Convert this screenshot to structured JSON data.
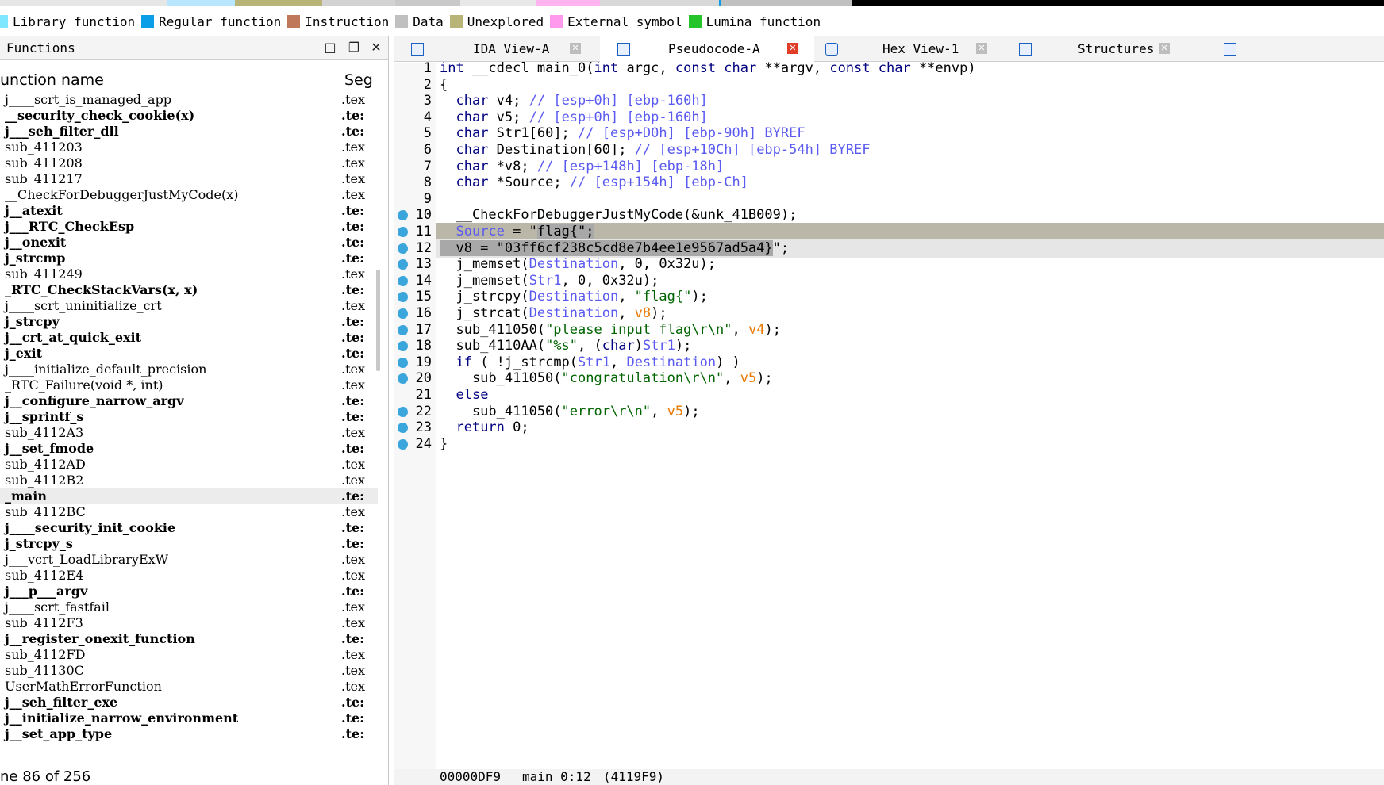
{
  "legend": [
    {
      "label": "Library function",
      "color": "#7fe7ff"
    },
    {
      "label": "Regular function",
      "color": "#0a9ee8"
    },
    {
      "label": "Instruction",
      "color": "#c0785a"
    },
    {
      "label": "Data",
      "color": "#c0c0c0"
    },
    {
      "label": "Unexplored",
      "color": "#b8b478"
    },
    {
      "label": "External symbol",
      "color": "#ff99ee"
    },
    {
      "label": "Lumina function",
      "color": "#25c42a"
    }
  ],
  "functions_panel": {
    "title": "Functions",
    "col_name": "unction name",
    "col_seg": "Seg",
    "status": "ne 86 of 256",
    "rows": [
      {
        "name": "j____scrt_is_managed_app",
        "seg": ".tex",
        "bold": false
      },
      {
        "name": "__security_check_cookie(x)",
        "seg": ".te:",
        "bold": true
      },
      {
        "name": "j___seh_filter_dll",
        "seg": ".te:",
        "bold": true
      },
      {
        "name": "sub_411203",
        "seg": ".tex",
        "bold": false
      },
      {
        "name": "sub_411208",
        "seg": ".tex",
        "bold": false
      },
      {
        "name": "sub_411217",
        "seg": ".tex",
        "bold": false
      },
      {
        "name": "__CheckForDebuggerJustMyCode(x)",
        "seg": ".tex",
        "bold": false
      },
      {
        "name": "j__atexit",
        "seg": ".te:",
        "bold": true
      },
      {
        "name": "j___RTC_CheckEsp",
        "seg": ".te:",
        "bold": true
      },
      {
        "name": "j__onexit",
        "seg": ".te:",
        "bold": true
      },
      {
        "name": "j_strcmp",
        "seg": ".te:",
        "bold": true
      },
      {
        "name": "sub_411249",
        "seg": ".tex",
        "bold": false
      },
      {
        "name": "_RTC_CheckStackVars(x, x)",
        "seg": ".te:",
        "bold": true
      },
      {
        "name": "j____scrt_uninitialize_crt",
        "seg": ".tex",
        "bold": false
      },
      {
        "name": "j_strcpy",
        "seg": ".te:",
        "bold": true
      },
      {
        "name": "j__crt_at_quick_exit",
        "seg": ".te:",
        "bold": true
      },
      {
        "name": "j_exit",
        "seg": ".te:",
        "bold": true
      },
      {
        "name": "j____initialize_default_precision",
        "seg": ".tex",
        "bold": false
      },
      {
        "name": "_RTC_Failure(void *, int)",
        "seg": ".tex",
        "bold": false
      },
      {
        "name": "j__configure_narrow_argv",
        "seg": ".te:",
        "bold": true
      },
      {
        "name": "j__sprintf_s",
        "seg": ".te:",
        "bold": true
      },
      {
        "name": "sub_4112A3",
        "seg": ".tex",
        "bold": false
      },
      {
        "name": "j__set_fmode",
        "seg": ".te:",
        "bold": true
      },
      {
        "name": "sub_4112AD",
        "seg": ".tex",
        "bold": false
      },
      {
        "name": "sub_4112B2",
        "seg": ".tex",
        "bold": false
      },
      {
        "name": "_main",
        "seg": ".te:",
        "bold": true,
        "selected": true
      },
      {
        "name": "sub_4112BC",
        "seg": ".tex",
        "bold": false
      },
      {
        "name": "j____security_init_cookie",
        "seg": ".te:",
        "bold": true
      },
      {
        "name": "j_strcpy_s",
        "seg": ".te:",
        "bold": true
      },
      {
        "name": "j___vcrt_LoadLibraryExW",
        "seg": ".tex",
        "bold": false
      },
      {
        "name": "sub_4112E4",
        "seg": ".tex",
        "bold": false
      },
      {
        "name": "j___p___argv",
        "seg": ".te:",
        "bold": true
      },
      {
        "name": "j____scrt_fastfail",
        "seg": ".tex",
        "bold": false
      },
      {
        "name": "sub_4112F3",
        "seg": ".tex",
        "bold": false
      },
      {
        "name": "j__register_onexit_function",
        "seg": ".te:",
        "bold": true
      },
      {
        "name": "sub_4112FD",
        "seg": ".tex",
        "bold": false
      },
      {
        "name": "sub_41130C",
        "seg": ".tex",
        "bold": false
      },
      {
        "name": "UserMathErrorFunction",
        "seg": ".tex",
        "bold": false
      },
      {
        "name": "j__seh_filter_exe",
        "seg": ".te:",
        "bold": true
      },
      {
        "name": "j__initialize_narrow_environment",
        "seg": ".te:",
        "bold": true
      },
      {
        "name": "j__set_app_type",
        "seg": ".te:",
        "bold": true
      }
    ]
  },
  "tabs": [
    {
      "label": "IDA View-A",
      "active": false
    },
    {
      "label": "Pseudocode-A",
      "active": true
    },
    {
      "label": "Hex View-1",
      "active": false
    },
    {
      "label": "Structures",
      "active": false
    }
  ],
  "code_lines": [
    {
      "n": "1",
      "bp": false,
      "hl": "",
      "html": "<span class='k'>int</span> __cdecl main_0(<span class='k'>int</span> argc, <span class='k'>const char</span> **argv, <span class='k'>const char</span> **envp)"
    },
    {
      "n": "2",
      "bp": false,
      "hl": "",
      "html": "{"
    },
    {
      "n": "3",
      "bp": false,
      "hl": "",
      "html": "  <span class='k'>char</span> v4; <span class='cm'>// [esp+0h] [ebp-160h]</span>"
    },
    {
      "n": "4",
      "bp": false,
      "hl": "",
      "html": "  <span class='k'>char</span> v5; <span class='cm'>// [esp+0h] [ebp-160h]</span>"
    },
    {
      "n": "5",
      "bp": false,
      "hl": "",
      "html": "  <span class='k'>char</span> Str1[60]; <span class='cm'>// [esp+D0h] [ebp-90h] BYREF</span>"
    },
    {
      "n": "6",
      "bp": false,
      "hl": "",
      "html": "  <span class='k'>char</span> Destination[60]; <span class='cm'>// [esp+10Ch] [ebp-54h] BYREF</span>"
    },
    {
      "n": "7",
      "bp": false,
      "hl": "",
      "html": "  <span class='k'>char</span> *v8; <span class='cm'>// [esp+148h] [ebp-18h]</span>"
    },
    {
      "n": "8",
      "bp": false,
      "hl": "",
      "html": "  <span class='k'>char</span> *Source; <span class='cm'>// [esp+154h] [ebp-Ch]</span>"
    },
    {
      "n": "9",
      "bp": false,
      "hl": "",
      "html": ""
    },
    {
      "n": "10",
      "bp": true,
      "hl": "",
      "html": "  __CheckForDebuggerJustMyCode(&amp;unk_41B009);"
    },
    {
      "n": "11",
      "bp": true,
      "hl": "hl1",
      "html": "  <span class='v'>Source</span> = \"<span class='sel'>flag{\";</span>"
    },
    {
      "n": "12",
      "bp": true,
      "hl": "hl2",
      "html": "<span class='sel'>  v8 = \"03ff6cf238c5cd8e7b4ee1e9567ad5a4}</span>\";"
    },
    {
      "n": "13",
      "bp": true,
      "hl": "",
      "html": "  j_memset(<span class='v'>Destination</span>, 0, 0x32u);"
    },
    {
      "n": "14",
      "bp": true,
      "hl": "",
      "html": "  j_memset(<span class='v'>Str1</span>, 0, 0x32u);"
    },
    {
      "n": "15",
      "bp": true,
      "hl": "",
      "html": "  j_strcpy(<span class='v'>Destination</span>, <span class='s'>\"flag{\"</span>);"
    },
    {
      "n": "16",
      "bp": true,
      "hl": "",
      "html": "  j_strcat(<span class='v'>Destination</span>, <span class='o'>v8</span>);"
    },
    {
      "n": "17",
      "bp": true,
      "hl": "",
      "html": "  sub_411050(<span class='s'>\"please input flag\\r\\n\"</span>, <span class='o'>v4</span>);"
    },
    {
      "n": "18",
      "bp": true,
      "hl": "",
      "html": "  sub_4110AA(<span class='s'>\"%s\"</span>, (<span class='k'>char</span>)<span class='v'>Str1</span>);"
    },
    {
      "n": "19",
      "bp": true,
      "hl": "",
      "html": "  <span class='k'>if</span> ( !j_strcmp(<span class='v'>Str1</span>, <span class='v'>Destination</span>) )"
    },
    {
      "n": "20",
      "bp": true,
      "hl": "",
      "html": "    sub_411050(<span class='s'>\"congratulation\\r\\n\"</span>, <span class='o'>v5</span>);"
    },
    {
      "n": "21",
      "bp": false,
      "hl": "",
      "html": "  <span class='k'>else</span>"
    },
    {
      "n": "22",
      "bp": true,
      "hl": "",
      "html": "    sub_411050(<span class='s'>\"error\\r\\n\"</span>, <span class='o'>v5</span>);"
    },
    {
      "n": "23",
      "bp": true,
      "hl": "",
      "html": "  <span class='k'>return</span> 0;"
    },
    {
      "n": "24",
      "bp": true,
      "hl": "",
      "html": "}"
    }
  ],
  "code_status": {
    "offset": "00000DF9",
    "location": "main 0:12",
    "address": "(4119F9)"
  }
}
